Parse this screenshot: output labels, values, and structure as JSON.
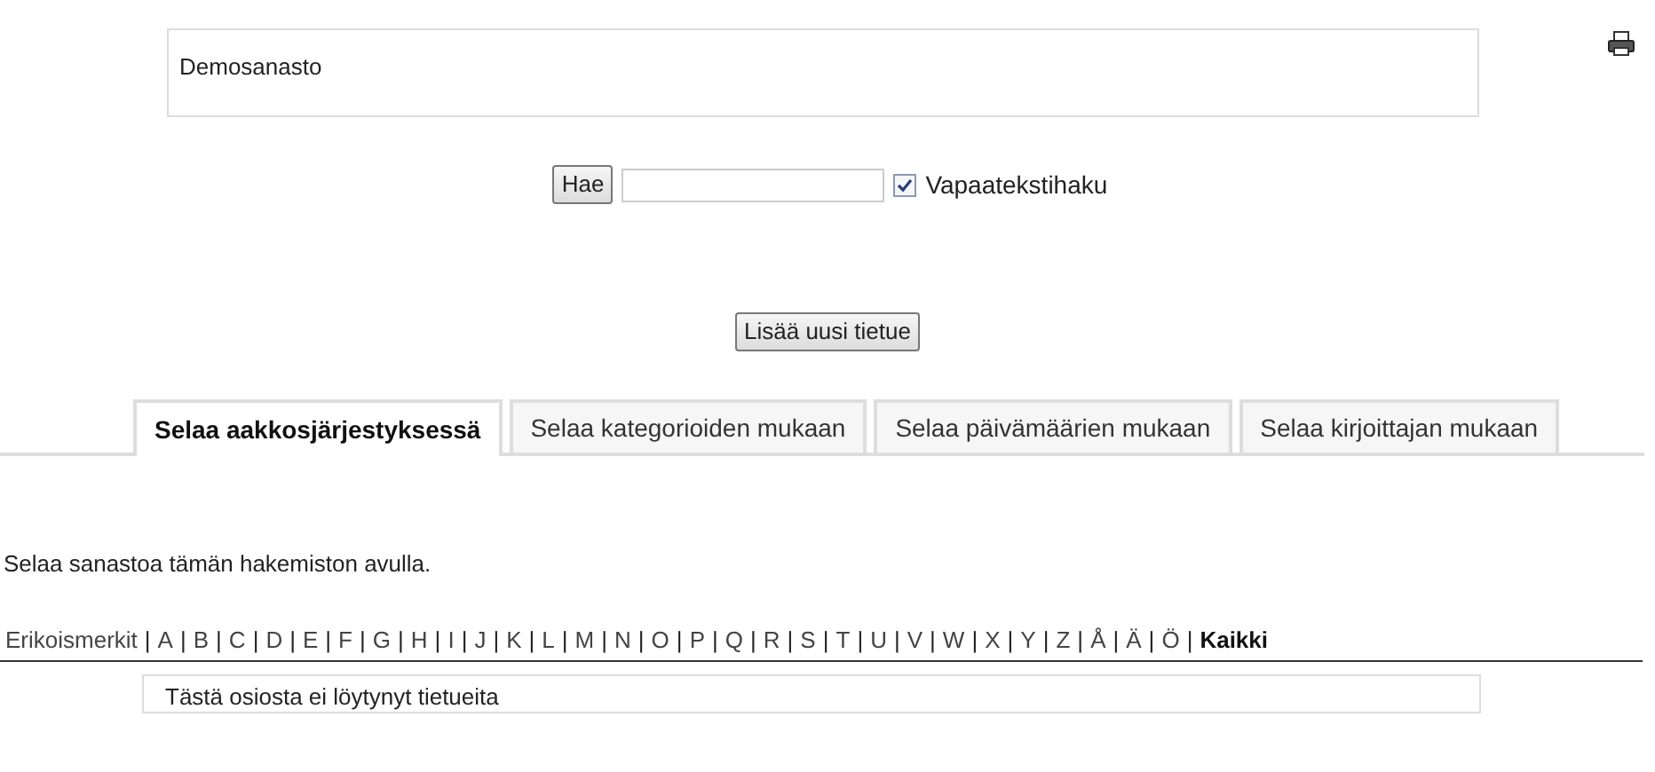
{
  "intro": {
    "text": "Demosanasto"
  },
  "search": {
    "button": "Hae",
    "fulltext": {
      "label": "Vapaatekstihaku",
      "checked": true
    }
  },
  "add_button": "Lisää uusi tietue",
  "tabs": [
    {
      "label": "Selaa aakkosjärjestyksessä",
      "selected": true
    },
    {
      "label": "Selaa kategorioiden mukaan",
      "selected": false
    },
    {
      "label": "Selaa päivämäärien mukaan",
      "selected": false
    },
    {
      "label": "Selaa kirjoittajan mukaan",
      "selected": false
    }
  ],
  "instructions": "Selaa sanastoa tämän hakemiston avulla.",
  "separator": "|",
  "letters": [
    {
      "label": "Erikoismerkit",
      "selected": false
    },
    {
      "label": "A",
      "selected": false
    },
    {
      "label": "B",
      "selected": false
    },
    {
      "label": "C",
      "selected": false
    },
    {
      "label": "D",
      "selected": false
    },
    {
      "label": "E",
      "selected": false
    },
    {
      "label": "F",
      "selected": false
    },
    {
      "label": "G",
      "selected": false
    },
    {
      "label": "H",
      "selected": false
    },
    {
      "label": "I",
      "selected": false
    },
    {
      "label": "J",
      "selected": false
    },
    {
      "label": "K",
      "selected": false
    },
    {
      "label": "L",
      "selected": false
    },
    {
      "label": "M",
      "selected": false
    },
    {
      "label": "N",
      "selected": false
    },
    {
      "label": "O",
      "selected": false
    },
    {
      "label": "P",
      "selected": false
    },
    {
      "label": "Q",
      "selected": false
    },
    {
      "label": "R",
      "selected": false
    },
    {
      "label": "S",
      "selected": false
    },
    {
      "label": "T",
      "selected": false
    },
    {
      "label": "U",
      "selected": false
    },
    {
      "label": "V",
      "selected": false
    },
    {
      "label": "W",
      "selected": false
    },
    {
      "label": "X",
      "selected": false
    },
    {
      "label": "Y",
      "selected": false
    },
    {
      "label": "Z",
      "selected": false
    },
    {
      "label": "Å",
      "selected": false
    },
    {
      "label": "Ä",
      "selected": false
    },
    {
      "label": "Ö",
      "selected": false
    },
    {
      "label": "Kaikki",
      "selected": true
    }
  ],
  "empty_message": "Tästä osiosta ei löytynyt tietueita"
}
